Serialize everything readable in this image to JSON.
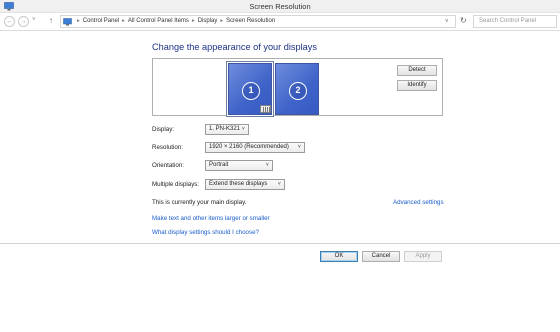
{
  "window": {
    "title": "Screen Resolution"
  },
  "address": {
    "breadcrumbs": [
      "Control Panel",
      "All Control Panel Items",
      "Display",
      "Screen Resolution"
    ],
    "search_placeholder": "Search Control Panel"
  },
  "heading": "Change the appearance of your displays",
  "preview": {
    "monitors": [
      {
        "number": "1",
        "selected": true
      },
      {
        "number": "2",
        "selected": false
      }
    ],
    "detect_label": "Detect",
    "identify_label": "Identify"
  },
  "settings": {
    "display": {
      "label": "Display:",
      "value": "1. PN-K321"
    },
    "resolution": {
      "label": "Resolution:",
      "value": "1920 × 2160 (Recommended)"
    },
    "orientation": {
      "label": "Orientation:",
      "value": "Portrait"
    },
    "multiple": {
      "label": "Multiple displays:",
      "value": "Extend these displays"
    }
  },
  "main_display_text": "This is currently your main display.",
  "links": {
    "advanced": "Advanced settings",
    "text_size": "Make text and other items larger or smaller",
    "which": "What display settings should I choose?"
  },
  "buttons": {
    "ok": "OK",
    "cancel": "Cancel",
    "apply": "Apply"
  },
  "colors": {
    "accent": "#1e3287",
    "link": "#1a5ec9",
    "monitor": "#4a6ccc"
  }
}
